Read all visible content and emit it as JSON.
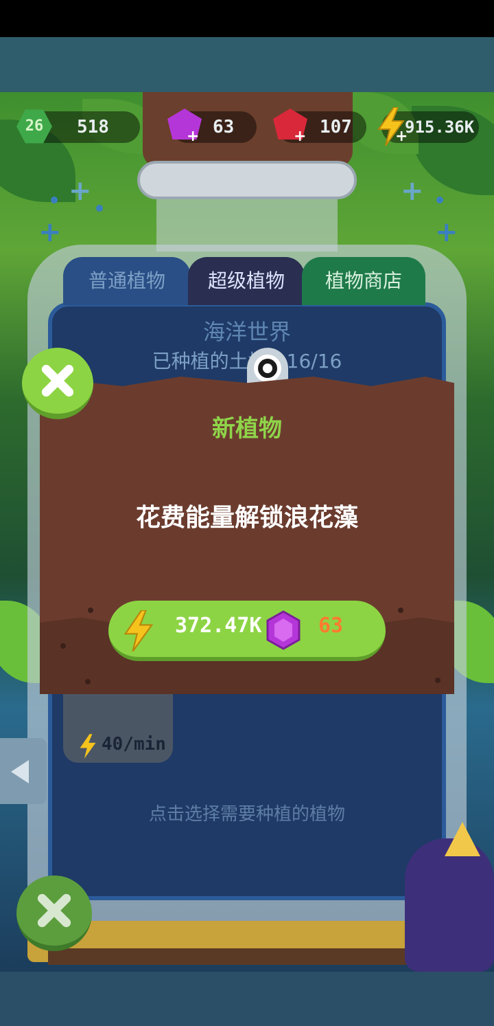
{
  "hud": {
    "level": "26",
    "xp": "518",
    "purple_gems": "63",
    "red_gems": "107",
    "energy": "915.36K"
  },
  "tabs": [
    {
      "label": "普通植物",
      "state": "inactive"
    },
    {
      "label": "超级植物",
      "state": "active"
    },
    {
      "label": "植物商店",
      "state": "inactive"
    }
  ],
  "world": {
    "name": "海洋世界",
    "soil_label": "已种植的土地：16/16"
  },
  "modal": {
    "title": "新植物",
    "message": "花费能量解锁浪花藻",
    "energy_cost": "372.47K",
    "gem_cost": "63"
  },
  "plant_card": {
    "rate": "40/min"
  },
  "hint": "点击选择需要种植的植物",
  "colors": {
    "accent_green": "#8dd444",
    "modal_brown": "#6b3c2e",
    "gem_cost_orange": "#ff7b2f",
    "energy_yellow": "#f5c31c",
    "purple_gem": "#b536d8",
    "red_gem": "#d9283a"
  },
  "icons": [
    "level-hex-icon",
    "purple-gem-icon",
    "red-gem-icon",
    "lightning-icon",
    "close-icon",
    "left-arrow-icon",
    "eye-icon"
  ]
}
